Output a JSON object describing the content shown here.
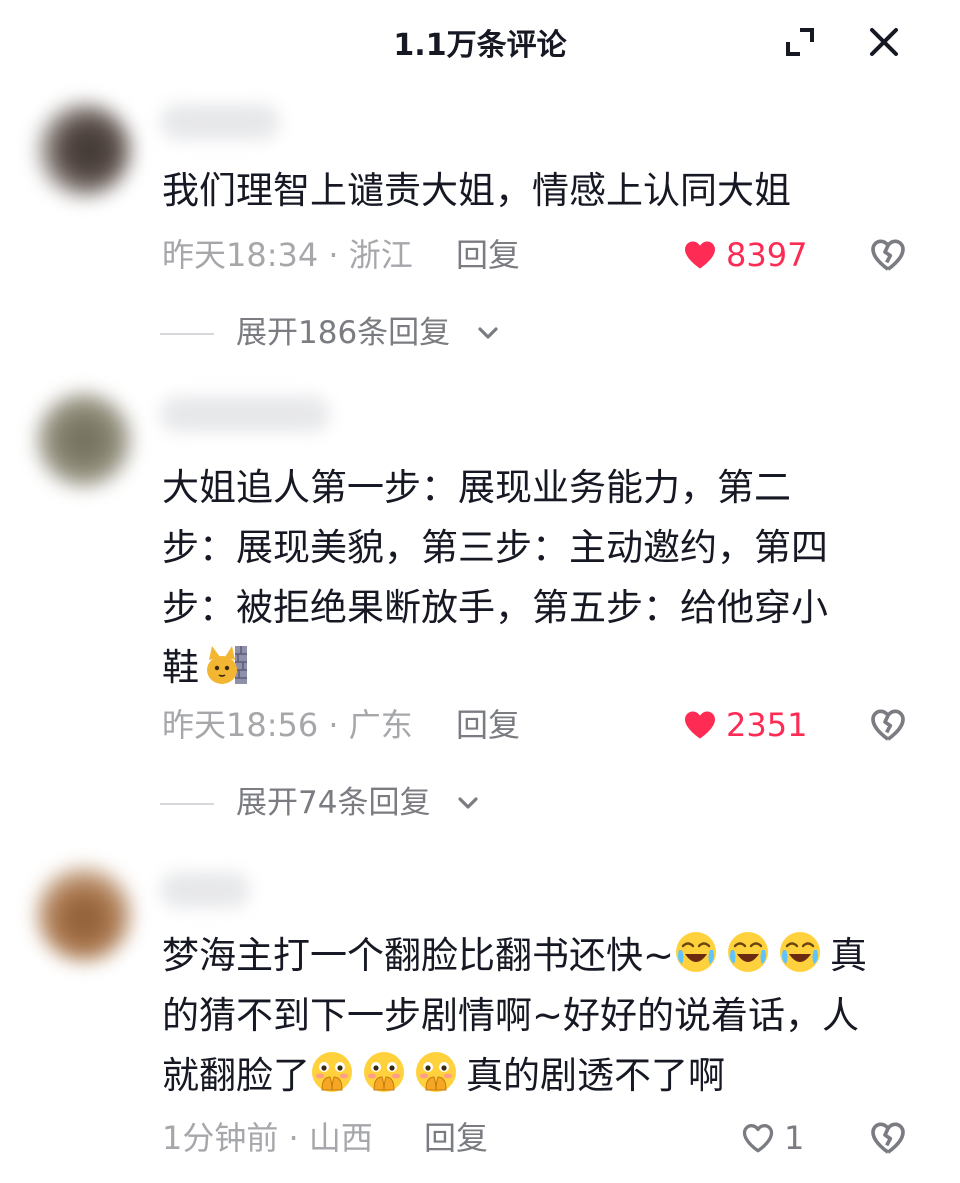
{
  "header": {
    "title": "1.1万条评论"
  },
  "colors": {
    "like_active": "#fe2c55",
    "meta_gray": "#a6a7ab",
    "reply_gray": "#7a7c82"
  },
  "comments": [
    {
      "lines": [
        "我们理智上谴责大姐，情感上认同大姐"
      ],
      "time_location": "昨天18:34 · 浙江",
      "reply_label": "回复",
      "likes": "8397",
      "liked": true,
      "expand_label": "展开186条回复"
    },
    {
      "lines": [
        "大姐追人第一步：展现业务能力，第二",
        "步：展现美貌，第三步：主动邀约，第四",
        "步：被拒绝果断放手，第五步：给他穿小",
        "鞋"
      ],
      "emoji_line4": "cat-behind-wall-emoji",
      "time_location": "昨天18:56 · 广东",
      "reply_label": "回复",
      "likes": "2351",
      "liked": true,
      "expand_label": "展开74条回复"
    },
    {
      "line1": "梦海主打一个翻脸比翻书还快~",
      "line1_tail": "真",
      "line2": "的猜不到下一步剧情啊~好好的说着话，人",
      "line3_head": "就翻脸了",
      "line3_tail": "真的剧透不了啊",
      "emojis_line1": [
        "laughing-crying-emoji",
        "laughing-crying-emoji",
        "laughing-crying-emoji"
      ],
      "emojis_line3": [
        "cover-mouth-emoji",
        "cover-mouth-emoji",
        "cover-mouth-emoji"
      ],
      "time_location": "1分钟前 · 山西",
      "reply_label": "回复",
      "likes": "1",
      "liked": false
    }
  ]
}
